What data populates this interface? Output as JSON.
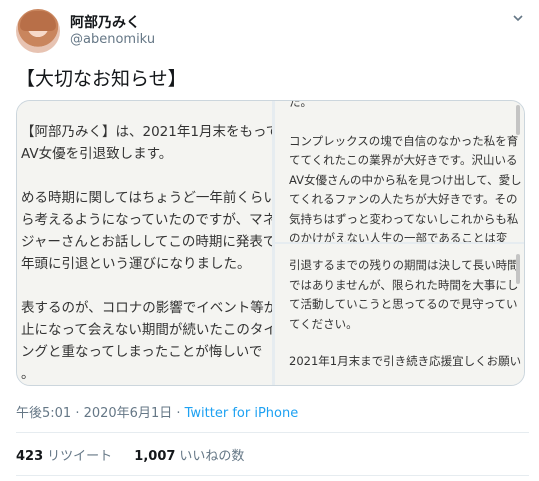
{
  "user": {
    "display_name": "阿部乃みく",
    "handle": "@abenomiku"
  },
  "tweet": {
    "text": "【大切なお知らせ】"
  },
  "media": {
    "left_panel": {
      "paragraphs": [
        [
          "【阿部乃みく】は、2021年1月末をもって",
          "AV女優を引退致します。"
        ],
        [
          "める時期に関してはちょうど一年前くらい",
          "ら考えるようになっていたのですが、マネ",
          "ジャーさんとお話ししてこの時期に発表で",
          "年頭に引退という運びになりました。"
        ],
        [
          "表するのが、コロナの影響でイベント等が",
          "止になって会えない期間が続いたこのタイ",
          "ングと重なってしまったことが悔しいで",
          "。"
        ]
      ]
    },
    "top_right_panel": {
      "paragraphs": [
        [
          "た。"
        ],
        [
          "コンプレックスの塊で自信のなかった私を育",
          "ててくれたこの業界が大好きです。沢山いる",
          "AV女優さんの中から私を見つけ出して、愛し",
          "てくれるファンの人たちが大好きです。その",
          "気持ちはずっと変わってないしこれからも私",
          "のかけがえない人生の一部であることは変"
        ]
      ]
    },
    "bottom_right_panel": {
      "paragraphs": [
        [
          "引退するまでの残りの期間は決して長い時間",
          "ではありませんが、限られた時間を大事にし",
          "て活動していこうと思ってるので見守ってい",
          "てください。"
        ],
        [
          "2021年1月末まで引き続き応援宜しくお願い"
        ]
      ]
    }
  },
  "meta": {
    "time": "午後5:01 · 2020年6月1日 · ",
    "source": "Twitter for iPhone"
  },
  "stats": {
    "retweets_count": "423",
    "retweets_label": "リツイート",
    "likes_count": "1,007",
    "likes_label": "いいねの数"
  }
}
